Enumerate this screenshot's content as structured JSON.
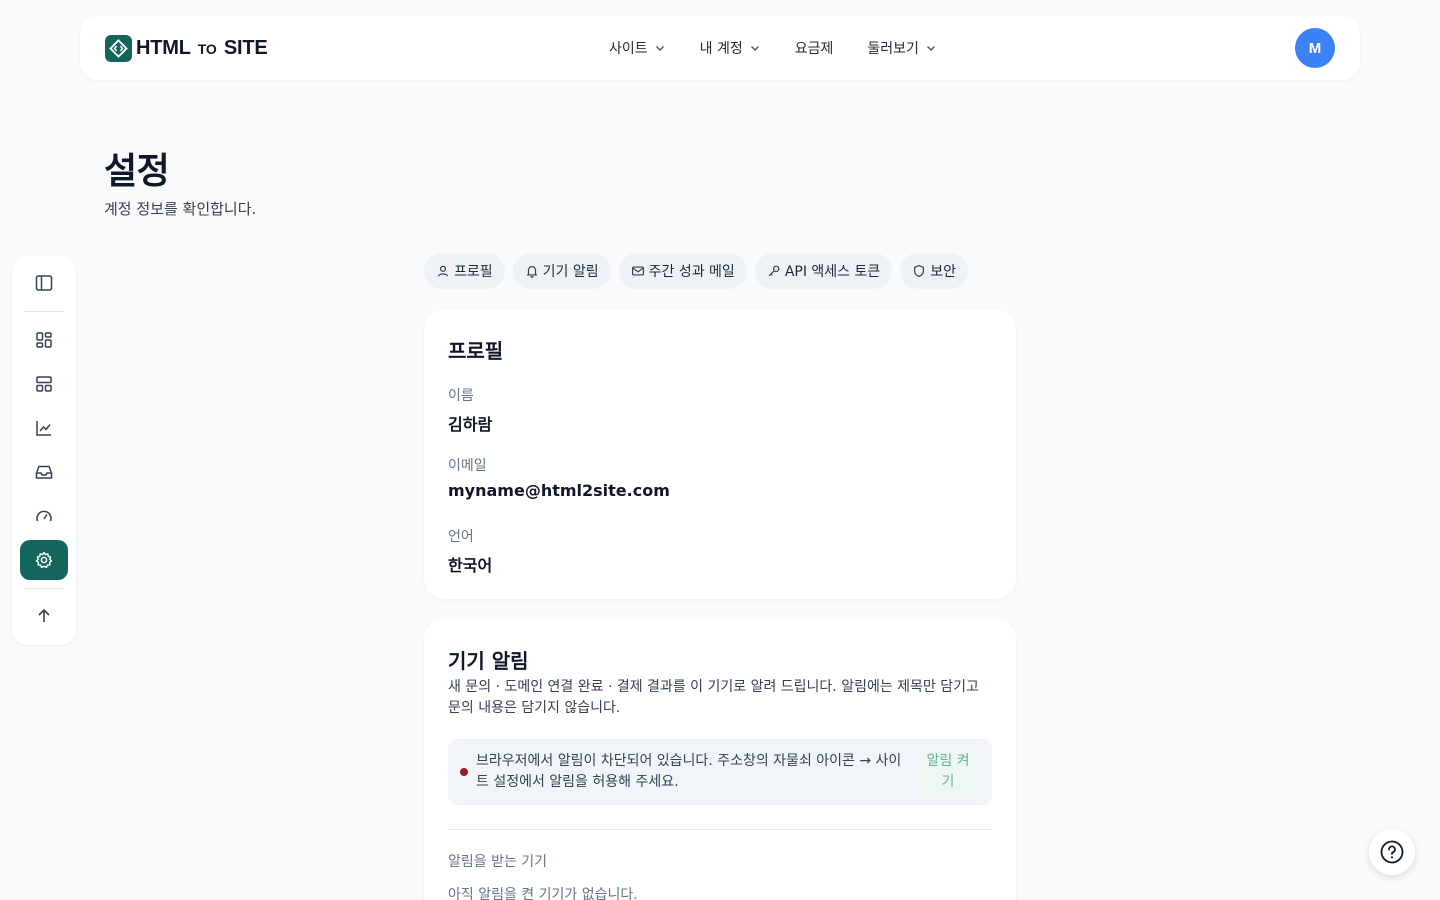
{
  "brand": {
    "name_left": "HTML",
    "name_mid": "TO",
    "name_right": "SITE",
    "color": "#14655c"
  },
  "nav": {
    "items": [
      {
        "label": "사이트",
        "dropdown": true
      },
      {
        "label": "내 계정",
        "dropdown": true
      },
      {
        "label": "요금제",
        "dropdown": false
      },
      {
        "label": "둘러보기",
        "dropdown": true
      }
    ],
    "avatar_initial": "M"
  },
  "page": {
    "title": "설정",
    "subtitle": "계정 정보를 확인합니다."
  },
  "sidebar": {
    "items": [
      "panel-toggle-icon",
      "dashboard-icon",
      "layout-icon",
      "chart-icon",
      "inbox-icon",
      "gauge-icon",
      "settings-icon",
      "arrow-up-icon"
    ],
    "active": "settings-icon"
  },
  "tabs": [
    {
      "label": "프로필",
      "icon": "user-icon"
    },
    {
      "label": "기기 알림",
      "icon": "bell-icon"
    },
    {
      "label": "주간 성과 메일",
      "icon": "mail-icon"
    },
    {
      "label": "API 액세스 토큰",
      "icon": "key-icon"
    },
    {
      "label": "보안",
      "icon": "shield-icon"
    }
  ],
  "profile": {
    "heading": "프로필",
    "name_label": "이름",
    "name_value": "김하람",
    "email_label": "이메일",
    "email_value": "myname@html2site.com",
    "lang_label": "언어",
    "lang_value": "한국어"
  },
  "notifications": {
    "heading": "기기 알림",
    "description": "새 문의 · 도메인 연결 완료 · 결제 결과를 이 기기로 알려 드립니다. 알림에는 제목만 담기고 문의 내용은 담기지 않습니다.",
    "alert_text": "브라우저에서 알림이 차단되어 있습니다. 주소창의 자물쇠 아이콘 → 사이트 설정에서 알림을 허용해 주세요.",
    "alert_button": "알림 켜기",
    "devices_label": "알림을 받는 기기",
    "devices_empty": "아직 알림을 켠 기기가 없습니다."
  }
}
